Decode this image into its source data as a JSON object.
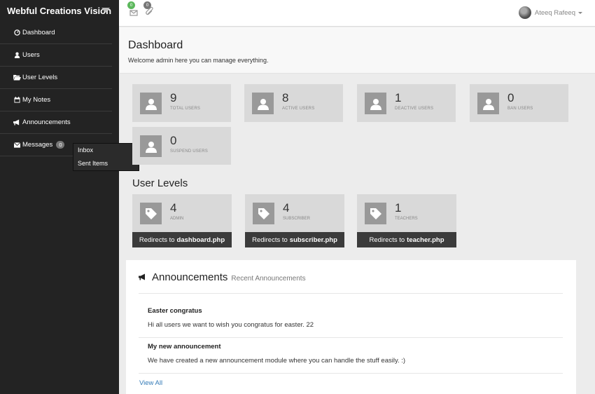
{
  "brand": "Webful Creations Vision",
  "nav": [
    {
      "label": "Dashboard",
      "icon": "dashboard-icon"
    },
    {
      "label": "Users",
      "icon": "user-icon"
    },
    {
      "label": "User Levels",
      "icon": "folder-open-icon"
    },
    {
      "label": "My Notes",
      "icon": "calendar-icon"
    },
    {
      "label": "Announcements",
      "icon": "bullhorn-icon"
    },
    {
      "label": "Messages",
      "icon": "envelope-icon",
      "badge": "0"
    }
  ],
  "messages_menu": {
    "inbox": "Inbox",
    "sent": "Sent Items"
  },
  "topbar": {
    "mail_badge": "0",
    "notes_badge": "0",
    "user_name": "Ateeq Rafeeq"
  },
  "header": {
    "title": "Dashboard",
    "welcome": "Welcome admin here you can manage everything."
  },
  "stats": [
    {
      "value": "9",
      "label": "TOTAL USERS"
    },
    {
      "value": "8",
      "label": "ACTIVE USERS"
    },
    {
      "value": "1",
      "label": "DEACTIVE USERS"
    },
    {
      "value": "0",
      "label": "BAN USERS"
    },
    {
      "value": "0",
      "label": "SUSPEND USERS"
    }
  ],
  "user_levels": {
    "title": "User Levels",
    "redirect_prefix": "Redirects to",
    "items": [
      {
        "value": "4",
        "label": "ADMIN",
        "page": "dashboard.php"
      },
      {
        "value": "4",
        "label": "SUBSCRIBER",
        "page": "subscriber.php"
      },
      {
        "value": "1",
        "label": "TEACHERS",
        "page": "teacher.php"
      }
    ]
  },
  "announcements": {
    "title": "Announcements",
    "subtitle": "Recent Announcements",
    "items": [
      {
        "title": "Easter congratus",
        "body": "Hi all users we want to wish you congratus for easter. 22"
      },
      {
        "title": "My new announcement",
        "body": "We have created a new announcement module where you can handle the stuff easily. :)"
      }
    ],
    "view_all": "View All"
  },
  "colors": {
    "sidebar_bg": "#232323",
    "badge_green": "#5cb85c",
    "badge_gray": "#777777",
    "link": "#337ab7"
  }
}
